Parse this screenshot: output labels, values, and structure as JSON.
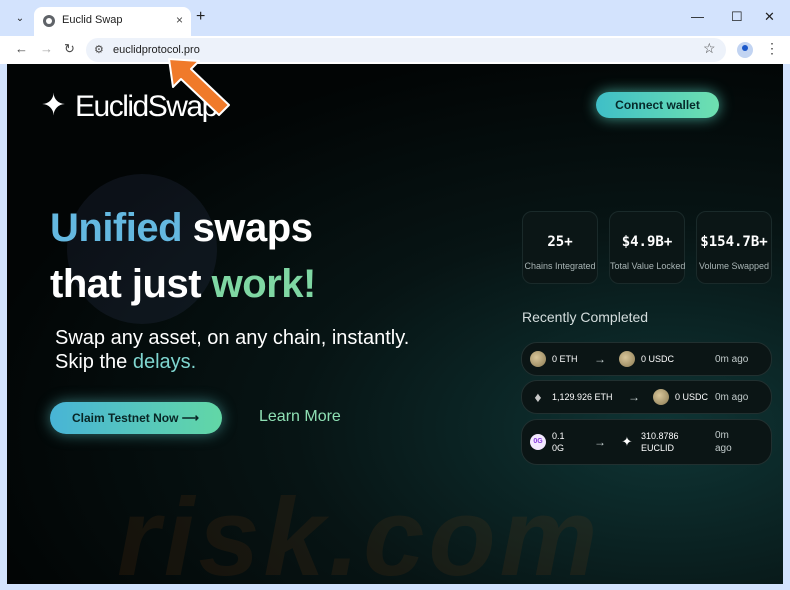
{
  "browser": {
    "tab_title": "Euclid Swap",
    "tab_close": "×",
    "new_tab": "+",
    "menu_glyph": "⌄",
    "url": "euclidprotocol.pro",
    "controls": {
      "minimize": "—",
      "maximize": "☐",
      "close": "✕"
    },
    "nav": {
      "back": "←",
      "forward": "→",
      "reload": "↻"
    },
    "star": "☆",
    "kebab": "⋮",
    "site_icon": "⚙"
  },
  "header": {
    "logo_text": "EuclidSwap",
    "logo_glyph": "✦",
    "connect_wallet": "Connect wallet"
  },
  "hero": {
    "line1_accent": "Unified",
    "line1_rest": " swaps",
    "line2_rest": "that just ",
    "line2_accent": "work!",
    "sub_line1": "Swap any asset, on any chain, instantly.",
    "sub_line2_rest": "Skip the ",
    "sub_line2_accent": "delays.",
    "cta_primary": "Claim Testnet Now ⟶",
    "cta_secondary": "Learn More"
  },
  "stats": [
    {
      "value": "25+",
      "label": "Chains Integrated"
    },
    {
      "value": "$4.9B+",
      "label": "Total Value Locked"
    },
    {
      "value": "$154.7B+",
      "label": "Volume Swapped"
    }
  ],
  "recent": {
    "title": "Recently Completed",
    "arrow_glyph": "→",
    "items": [
      {
        "from_amount": "0 ETH",
        "to_amount": "0 USDC",
        "ago": "0m ago"
      },
      {
        "from_amount": "1,129.926 ETH",
        "to_amount": "0 USDC",
        "ago": "0m ago"
      },
      {
        "from_amount": "0.1 0G",
        "to_amount": "310.8786 EUCLID",
        "ago": "0m ago"
      }
    ],
    "og_badge": "0G",
    "eth_glyph": "♦",
    "euclid_glyph": "✦"
  },
  "watermark": {
    "text": "risk.com"
  },
  "colors": {
    "accent_teal": "#3fbfc7",
    "accent_green": "#7fd7a3",
    "accent_blue": "#64b8e0",
    "annotation_orange": "#f07a2a"
  },
  "icons": [
    "chevron-down-icon",
    "globe-icon",
    "close-icon",
    "plus-icon",
    "back-arrow-icon",
    "forward-arrow-icon",
    "reload-icon",
    "site-settings-icon",
    "star-icon",
    "profile-icon",
    "kebab-menu-icon",
    "sparkle-logo-icon",
    "arrow-right-icon",
    "eth-token-icon",
    "usdc-token-icon",
    "og-token-icon",
    "euclid-token-icon",
    "pointer-arrow-icon"
  ]
}
